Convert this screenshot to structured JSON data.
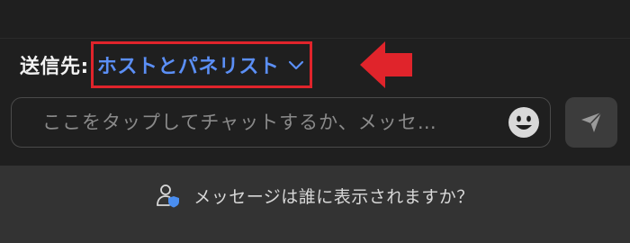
{
  "recipient": {
    "label": "送信先:",
    "value": "ホストとパネリスト"
  },
  "chat_input": {
    "placeholder": "ここをタップしてチャットするか、メッセ…"
  },
  "footer": {
    "privacy_text": "メッセージは誰に表示されますか？"
  },
  "icons": {
    "chevron": "chevron-down-icon",
    "emoji": "emoji-icon",
    "send": "send-icon",
    "privacy": "user-shield-icon",
    "annotation_arrow": "arrow-left-icon"
  },
  "colors": {
    "accent_blue": "#5b8ff6",
    "highlight_red": "#e0242b",
    "background": "#1f1f1f",
    "footer_bg": "#333333"
  }
}
